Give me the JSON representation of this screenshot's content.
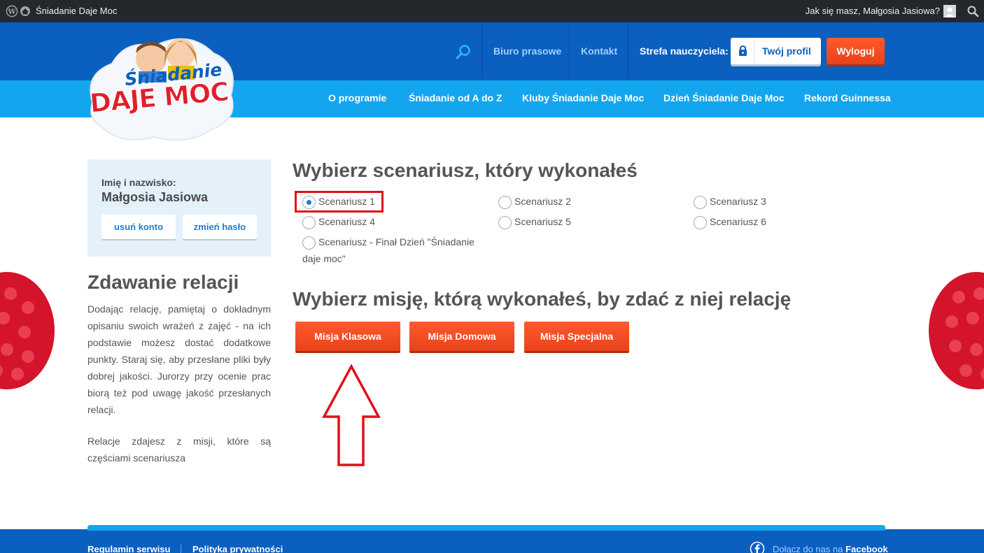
{
  "adminbar": {
    "site_name": "Śniadanie Daje Moc",
    "howdy": "Jak się masz, Małgosia Jasiowa?"
  },
  "logo": {
    "line1": "Śniadanie",
    "line2": "DAJE MOC"
  },
  "header": {
    "links": [
      "Biuro prasowe",
      "Kontakt"
    ],
    "teacher_zone": "Strefa nauczyciela:",
    "profile_button": "Twój profil",
    "logout_button": "Wyloguj"
  },
  "nav": {
    "items": [
      "O programie",
      "Śniadanie od A do Z",
      "Kluby Śniadanie Daje Moc",
      "Dzień Śniadanie Daje Moc",
      "Rekord Guinnessa"
    ]
  },
  "sidebar": {
    "name_label": "Imię i nazwisko:",
    "name": "Małgosia Jasiowa",
    "delete_account": "usuń konto",
    "change_password": "zmień hasło",
    "title": "Zdawanie relacji",
    "paragraph1": "Dodając relację, pamiętaj o dokładnym opisaniu swoich wrażeń z zajęć - na ich podstawie możesz dostać dodatkowe punkty. Staraj się, aby przesłane pliki były dobrej jakości. Jurorzy przy ocenie prac biorą też pod uwagę jakość przesłanych relacji.",
    "paragraph2": "Relacje zdajesz z misji, które są częściami scenariusza"
  },
  "main": {
    "scenario_heading": "Wybierz scenariusz, który wykonałeś",
    "scenarios": [
      {
        "label": "Scenariusz 1",
        "selected": true
      },
      {
        "label": "Scenariusz 2",
        "selected": false
      },
      {
        "label": "Scenariusz 3",
        "selected": false
      },
      {
        "label": "Scenariusz 4",
        "selected": false
      },
      {
        "label": "Scenariusz 5",
        "selected": false
      },
      {
        "label": "Scenariusz 6",
        "selected": false
      }
    ],
    "final_scenario": {
      "line1": "Scenariusz - Finał Dzień \"Śniadanie",
      "line2": "daje moc\"",
      "selected": false
    },
    "mission_heading": "Wybierz misję, którą wykonałeś, by zdać z niej relację",
    "missions": [
      "Misja Klasowa",
      "Misja Domowa",
      "Misja Specjalna"
    ]
  },
  "footer": {
    "links": [
      "Regulamin serwisu",
      "Polityka prywatności"
    ],
    "fb_prefix": "Dołącz do nas na",
    "fb_name": "Facebook"
  },
  "colors": {
    "header_dark_blue": "#0a5fbf",
    "nav_light_blue": "#13a6ee",
    "button_orange": "#e8421b",
    "highlight_red": "#e0101a"
  }
}
